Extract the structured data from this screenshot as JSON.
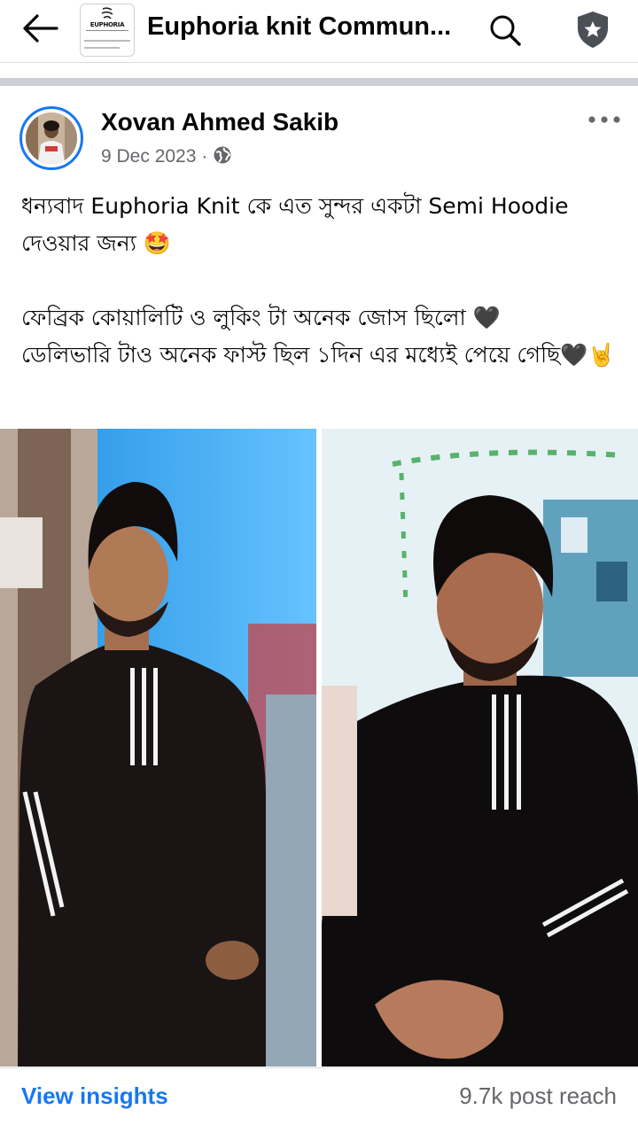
{
  "header": {
    "group_title": "Euphoria knit Commun...",
    "logo_word": "EUPHORIA"
  },
  "post": {
    "author": "Xovan Ahmed Sakib",
    "date": "9 Dec 2023",
    "separator": "·",
    "paragraphs": [
      "ধন্যবাদ Euphoria Knit কে এত সুন্দর একটা Semi Hoodie দেওয়ার জন্য 🤩",
      "ফেব্রিক কোয়ালিটি ও লুকিং টা অনেক জোস ছিলো 🖤\n ডেলিভারি টাও অনেক ফাস্ট ছিল ১দিন এর মধ্যেই পেয়ে গেছি🖤🤘"
    ]
  },
  "footer": {
    "insights_label": "View insights",
    "reach_label": "9.7k post reach"
  },
  "colors": {
    "accent": "#1877f2",
    "secondary_text": "#65676b",
    "divider": "#ccd0d5"
  },
  "icons": [
    "back-arrow-icon",
    "search-icon",
    "shield-star-icon",
    "globe-icon",
    "more-dots-icon"
  ]
}
